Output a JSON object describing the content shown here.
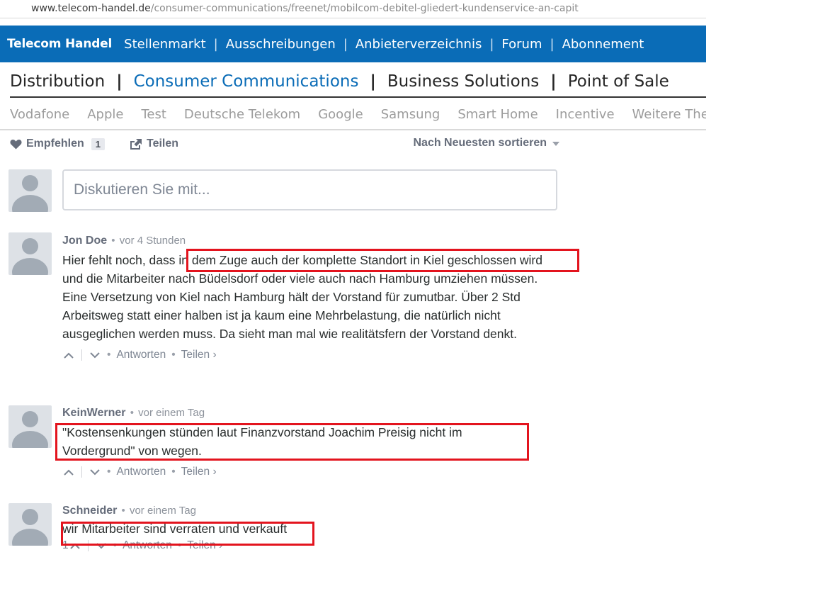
{
  "url": {
    "domain": "www.telecom-handel.de",
    "path": "/consumer-communications/freenet/mobilcom-debitel-gliedert-kundenservice-an-capit"
  },
  "topnav": {
    "brand": "Telecom Handel",
    "items": [
      "Stellenmarkt",
      "Ausschreibungen",
      "Anbieterverzeichnis",
      "Forum",
      "Abonnement"
    ],
    "background": "#0a6cb7"
  },
  "sections": {
    "items": [
      "Distribution",
      "Consumer Communications",
      "Business Solutions",
      "Point of Sale"
    ],
    "active": "Consumer Communications"
  },
  "tags": [
    "Vodafone",
    "Apple",
    "Test",
    "Deutsche Telekom",
    "Google",
    "Samsung",
    "Smart Home",
    "Incentive",
    "Weitere Themen"
  ],
  "toolbar": {
    "recommend_label": "Empfehlen",
    "recommend_count": "1",
    "share_label": "Teilen",
    "sort_label": "Nach Neuesten sortieren"
  },
  "composer": {
    "placeholder": "Diskutieren Sie mit..."
  },
  "comments": [
    {
      "author": "Jon Doe",
      "time": "vor 4 Stunden",
      "text": "Hier fehlt noch, dass in dem Zuge auch der komplette Standort in Kiel geschlossen wird und die Mitarbeiter nach Büdelsdorf oder viele auch nach Hamburg umziehen müssen. Eine Versetzung von Kiel nach Hamburg hält der Vorstand für zumutbar. Über 2 Std Arbeitsweg statt einer halben ist ja kaum eine Mehrbelastung, die natürlich nicht ausgeglichen werden muss. Da sieht man mal wie realitätsfern der Vorstand denkt.",
      "upvotes": "",
      "reply": "Antworten",
      "share": "Teilen ›"
    },
    {
      "author": "KeinWerner",
      "time": "vor einem Tag",
      "text": "\"Kostensenkungen stünden laut Finanzvorstand Joachim Preisig nicht im Vordergrund\" von wegen.",
      "upvotes": "",
      "reply": "Antworten",
      "share": "Teilen ›"
    },
    {
      "author": "Schneider",
      "time": "vor einem Tag",
      "text": "wir Mitarbeiter sind verraten und verkauft",
      "upvotes": "1",
      "reply": "Antworten",
      "share": "Teilen ›"
    }
  ],
  "highlight_color": "#e3141e"
}
